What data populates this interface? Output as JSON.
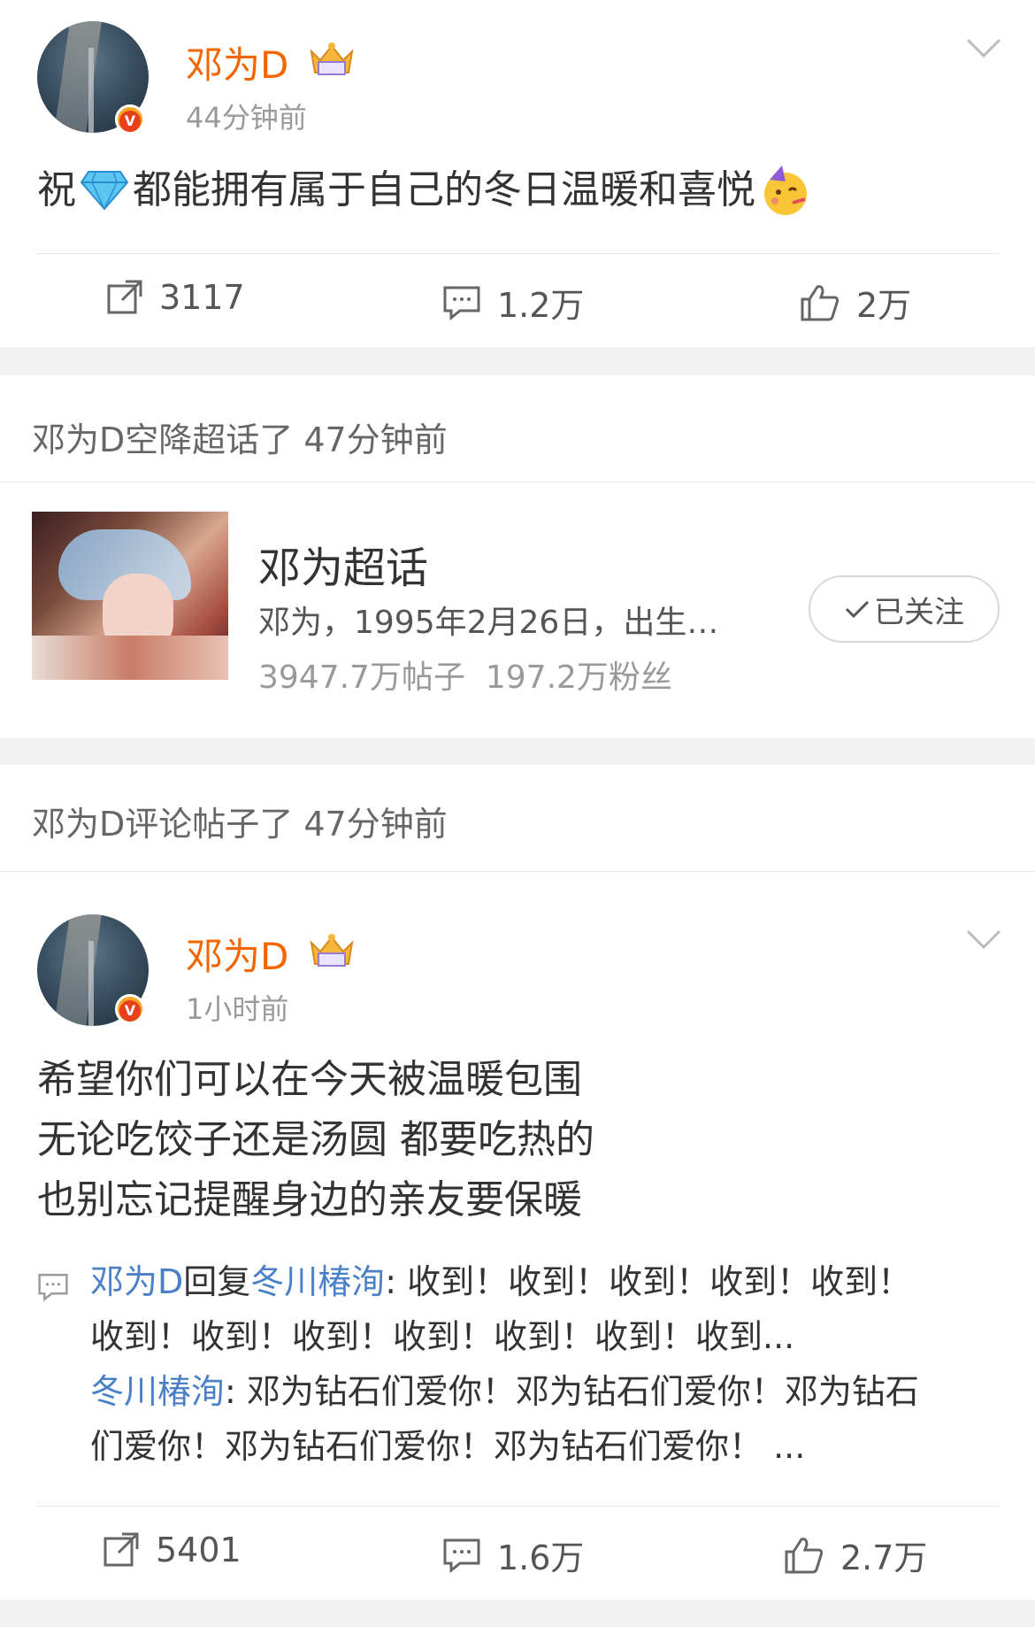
{
  "post1": {
    "username": "邓为D",
    "time": "44分钟前",
    "text_parts": [
      "祝",
      "都能拥有属于自己的冬日温暖和喜悦"
    ],
    "emojis": [
      "diamond-emoji",
      "party-face-emoji"
    ],
    "actions": {
      "repost": "3117",
      "comment": "1.2万",
      "like": "2万"
    }
  },
  "activity1": {
    "text": "邓为D空降超话了 47分钟前"
  },
  "topic": {
    "name": "邓为超话",
    "desc": "邓为，1995年2月26日，出生…",
    "stats": "3947.7万帖子  197.2万粉丝",
    "follow_label": "已关注"
  },
  "activity2": {
    "text": "邓为D评论帖子了 47分钟前"
  },
  "post2": {
    "username": "邓为D",
    "time": "1小时前",
    "lines": [
      "希望你们可以在今天被温暖包围",
      "无论吃饺子还是汤圆 都要吃热的",
      "也别忘记提醒身边的亲友要保暖"
    ],
    "reply1": {
      "author": "邓为D",
      "verb": "回复",
      "target": "冬川椿洵",
      "line1": ": 收到！收到！收到！收到！收到！",
      "line2": "收到！收到！收到！收到！收到！收到！收到..."
    },
    "reply2": {
      "author": "冬川椿洵",
      "line1": ": 邓为钻石们爱你！邓为钻石们爱你！邓为钻石",
      "line2": "们爱你！邓为钻石们爱你！邓为钻石们爱你！ ..."
    },
    "actions": {
      "repost": "5401",
      "comment": "1.6万",
      "like": "2.7万"
    }
  },
  "colors": {
    "username": "#f26500",
    "link": "#4a80c8",
    "badge": "#f5a623"
  }
}
